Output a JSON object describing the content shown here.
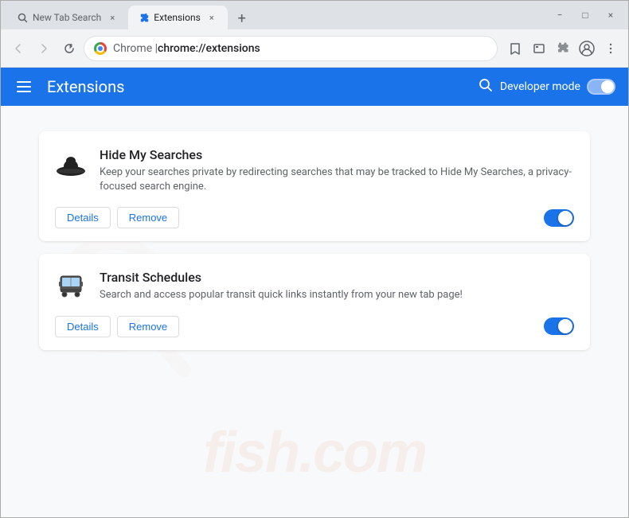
{
  "browser": {
    "tabs": [
      {
        "id": "tab-1",
        "label": "New Tab Search",
        "active": false,
        "icon": "search"
      },
      {
        "id": "tab-2",
        "label": "Extensions",
        "active": true,
        "icon": "puzzle"
      }
    ],
    "new_tab_button": "+",
    "address_bar": {
      "prefix": "Chrome  |  ",
      "url": "chrome://extensions",
      "chrome_text": "Chrome",
      "separator": "|",
      "path": "chrome://extensions"
    },
    "window_controls": {
      "minimize": "−",
      "maximize": "□",
      "close": "×"
    }
  },
  "extensions_page": {
    "header": {
      "menu_label": "menu",
      "title": "Extensions",
      "search_label": "search",
      "developer_mode_label": "Developer mode",
      "toggle_on": true
    },
    "extensions": [
      {
        "id": "hide-my-searches",
        "name": "Hide My Searches",
        "description": "Keep your searches private by redirecting searches that may be tracked to Hide My Searches, a privacy-focused search engine.",
        "icon": "hat",
        "enabled": true,
        "details_label": "Details",
        "remove_label": "Remove"
      },
      {
        "id": "transit-schedules",
        "name": "Transit Schedules",
        "description": "Search and access popular transit quick links instantly from your new tab page!",
        "icon": "bus",
        "enabled": true,
        "details_label": "Details",
        "remove_label": "Remove"
      }
    ],
    "watermark_text": "fish.com"
  }
}
